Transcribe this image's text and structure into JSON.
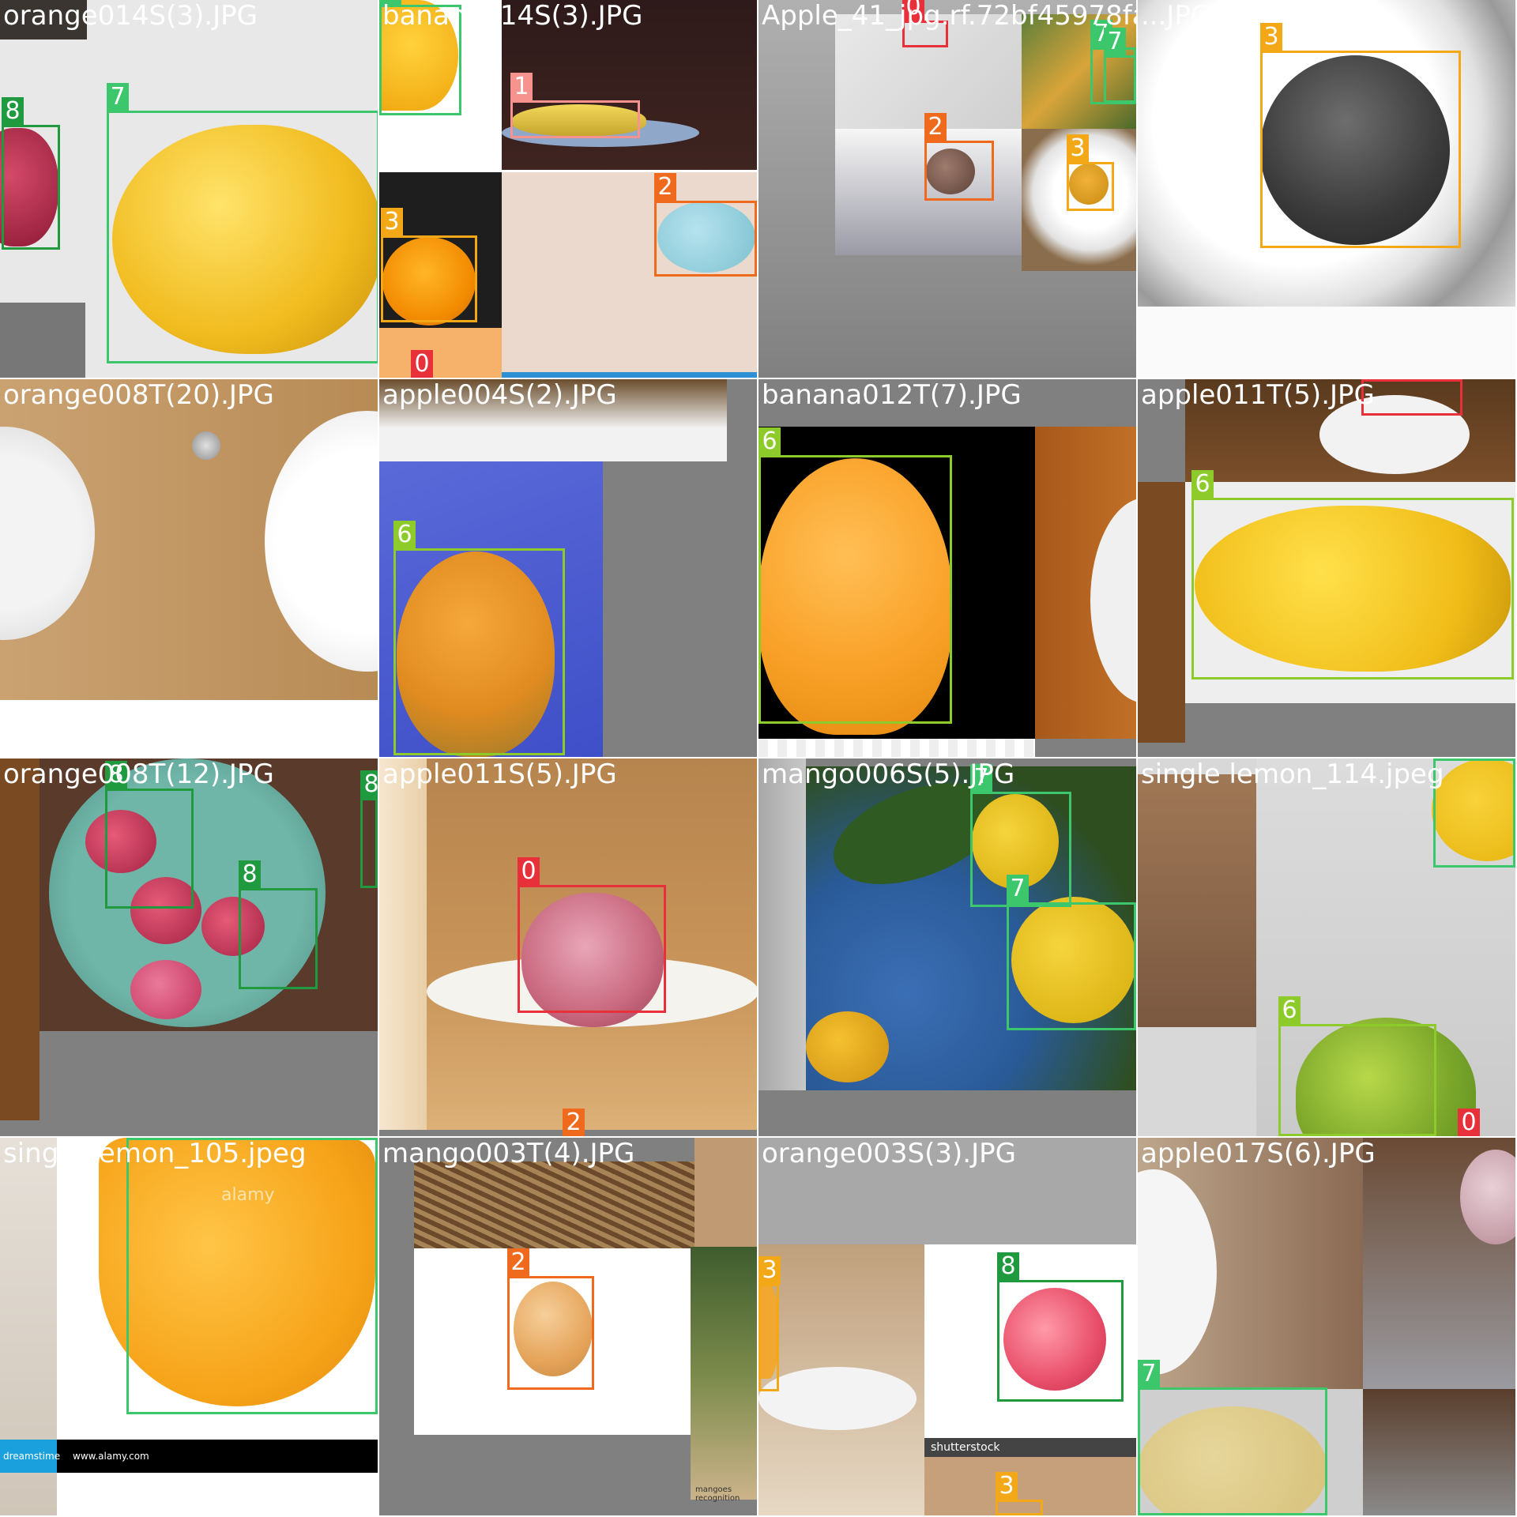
{
  "class_colors": {
    "0": "#e8303b",
    "1": "#f6938f",
    "2": "#ef6a1c",
    "3": "#f2a817",
    "6": "#8ccb29",
    "7": "#3cc76d",
    "8": "#1f9a3f"
  },
  "tiles": [
    {
      "label": "orange014S(3).JPG",
      "boxes": [
        {
          "class": "8"
        },
        {
          "class": "7"
        }
      ]
    },
    {
      "label": "banana014S(3).JPG",
      "boxes": [
        {
          "class": "7"
        },
        {
          "class": "1"
        },
        {
          "class": "3"
        },
        {
          "class": "2"
        },
        {
          "class": "0"
        }
      ]
    },
    {
      "label": "Apple_41_jpg.rf.72bf45978fadaf...",
      "boxes": [
        {
          "class": "0"
        },
        {
          "class": "7"
        },
        {
          "class": "7"
        },
        {
          "class": "2"
        },
        {
          "class": "3"
        }
      ]
    },
    {
      "label": "...JPG",
      "boxes": [
        {
          "class": "3"
        }
      ]
    },
    {
      "label": "orange008T(20).JPG",
      "boxes": []
    },
    {
      "label": "apple004S(2).JPG",
      "boxes": [
        {
          "class": "6"
        }
      ]
    },
    {
      "label": "banana012T(7).JPG",
      "boxes": [
        {
          "class": "6"
        }
      ]
    },
    {
      "label": "apple011T(5).JPG",
      "boxes": [
        {
          "class": "0"
        },
        {
          "class": "6"
        }
      ]
    },
    {
      "label": "orange008T(12).JPG",
      "boxes": [
        {
          "class": "8"
        },
        {
          "class": "8"
        },
        {
          "class": "8"
        }
      ]
    },
    {
      "label": "apple011S(5).JPG",
      "boxes": [
        {
          "class": "0"
        },
        {
          "class": "2"
        }
      ]
    },
    {
      "label": "mango006S(5).JPG",
      "boxes": [
        {
          "class": "7"
        },
        {
          "class": "7"
        }
      ]
    },
    {
      "label": "single lemon_114.jpeg",
      "boxes": [
        {
          "class": "7"
        },
        {
          "class": "6"
        },
        {
          "class": "0"
        }
      ]
    },
    {
      "label": "single lemon_105.jpeg",
      "boxes": [
        {
          "class": "7"
        }
      ]
    },
    {
      "label": "mango003T(4).JPG",
      "boxes": [
        {
          "class": "2"
        }
      ]
    },
    {
      "label": "orange003S(3).JPG",
      "boxes": [
        {
          "class": "3"
        },
        {
          "class": "8"
        },
        {
          "class": "3"
        }
      ]
    },
    {
      "label": "apple017S(6).JPG",
      "boxes": [
        {
          "class": "7"
        }
      ]
    }
  ],
  "watermarks": {
    "alamy_lemon": "alamy",
    "dreamstime": "dreamstime",
    "alamy_url": "www.alamy.com",
    "shutterstock": "shutterstock",
    "mango_caption": "mangoes recognition"
  }
}
